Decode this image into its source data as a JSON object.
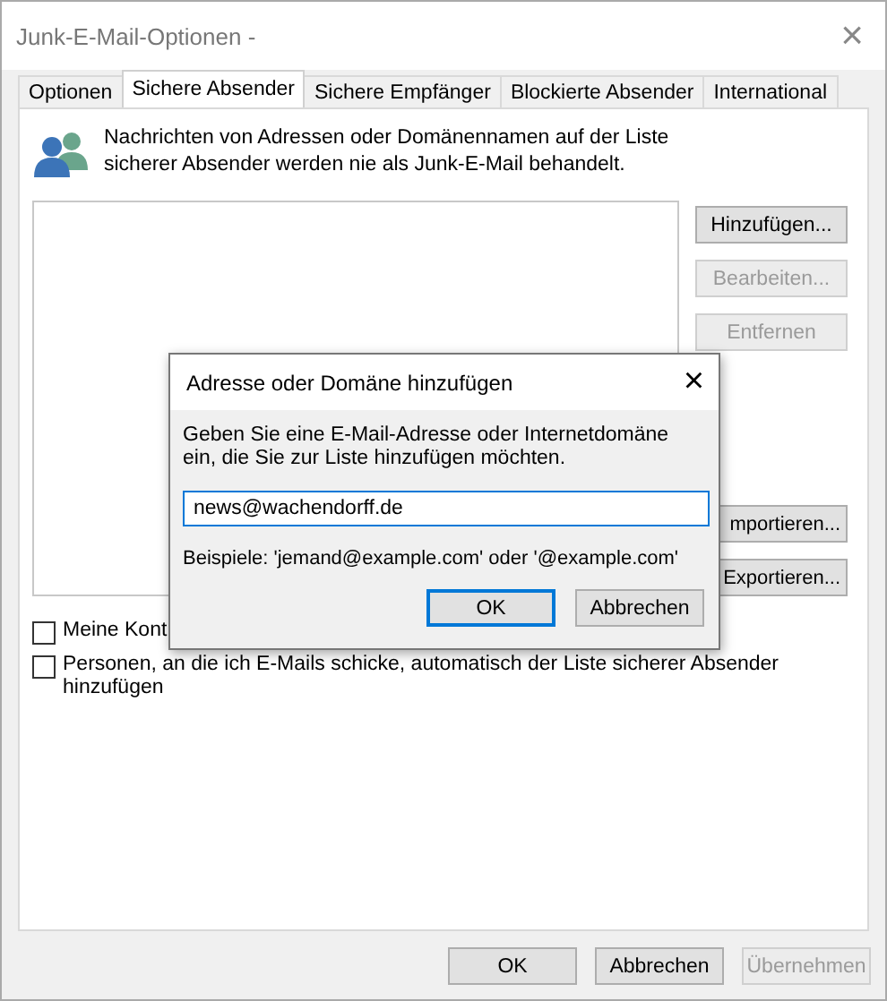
{
  "window": {
    "title": "Junk-E-Mail-Optionen -",
    "close": "×"
  },
  "tabs": [
    {
      "label": "Optionen",
      "selected": false
    },
    {
      "label": "Sichere Absender",
      "selected": true
    },
    {
      "label": "Sichere Empfänger",
      "selected": false
    },
    {
      "label": "Blockierte Absender",
      "selected": false
    },
    {
      "label": "International",
      "selected": false
    }
  ],
  "description": "Nachrichten von Adressen oder Domänennamen auf der Liste sicherer Absender werden nie als Junk-E-Mail behandelt.",
  "side_buttons_top": [
    {
      "label": "Hinzufügen...",
      "disabled": false
    },
    {
      "label": "Bearbeiten...",
      "disabled": true
    },
    {
      "label": "Entfernen",
      "disabled": true
    }
  ],
  "side_buttons_bottom": [
    {
      "label": "mportieren...",
      "disabled": false
    },
    {
      "label": "Exportieren...",
      "disabled": false
    }
  ],
  "checkboxes": [
    {
      "label": "Meine Kont",
      "checked": false
    },
    {
      "label": "Personen, an die ich E-Mails schicke, automatisch der Liste sicherer Absender hinzufügen",
      "checked": false
    }
  ],
  "footer_buttons": [
    {
      "label": "OK",
      "disabled": false
    },
    {
      "label": "Abbrechen",
      "disabled": false
    },
    {
      "label": "Übernehmen",
      "disabled": true
    }
  ],
  "dialog": {
    "title": "Adresse oder Domäne hinzufügen",
    "close": "×",
    "prompt": "Geben Sie eine E-Mail-Adresse oder Internetdomäne ein, die Sie zur Liste hinzufügen möchten.",
    "value": "news@wachendorff.de",
    "example": "Beispiele: 'jemand@example.com' oder '@example.com'",
    "buttons": [
      {
        "label": "OK",
        "default": true
      },
      {
        "label": "Abbrechen",
        "default": false
      }
    ]
  }
}
